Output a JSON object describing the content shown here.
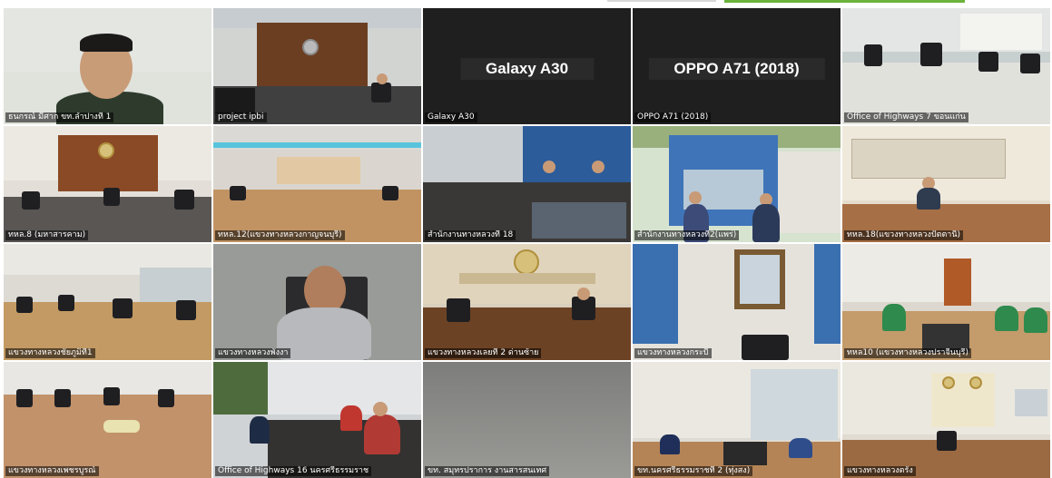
{
  "tiles": [
    {
      "id": "t1",
      "label": "ธนกรณ์ มีศาก ขท.ลำปางที่ 1"
    },
    {
      "id": "t2",
      "label": "project ipbi"
    },
    {
      "id": "t3",
      "label": "Galaxy A30",
      "center_name": "Galaxy A30"
    },
    {
      "id": "t4",
      "label": "OPPO A71 (2018)",
      "center_name": "OPPO A71 (2018)"
    },
    {
      "id": "t5",
      "label": "Office of Highways 7 ขอนแก่น"
    },
    {
      "id": "t6",
      "label": "ทหล.8 (มหาสารคาม)"
    },
    {
      "id": "t7",
      "label": "ทหล.12(แขวงทางหลวงกาญจนบุรี)"
    },
    {
      "id": "t8",
      "label": "สำนักงานทางหลวงที่ 18"
    },
    {
      "id": "t9",
      "label": "สำนักงานทางหลวงที่2(แพร่)"
    },
    {
      "id": "t10",
      "label": "ทหล.18(แขวงทางหลวงปัตตานี)"
    },
    {
      "id": "t11",
      "label": "แขวงทางหลวงชัยภูมิที่1"
    },
    {
      "id": "t12",
      "label": "แขวงทางหลวงพังงา"
    },
    {
      "id": "t13",
      "label": "แขวงทางหลวงเลยที่ 2 ด่านซ้าย"
    },
    {
      "id": "t14",
      "label": "แขวงทางหลวงกระบี่"
    },
    {
      "id": "t15",
      "label": "ทหล10 (แขวงทางหลวงปราจีนบุรี)"
    },
    {
      "id": "t16",
      "label": "แขวงทางหลวงเพชรบูรณ์"
    },
    {
      "id": "t17",
      "label": "Office of Highways 16 นครศรีธรรมราช"
    },
    {
      "id": "t18",
      "label": "ขท. สมุทรปราการ งานสารสนเทศ"
    },
    {
      "id": "t19",
      "label": "ขท.นครศรีธรรมราชที่ 2 (ทุ่งสง)"
    },
    {
      "id": "t20",
      "label": "แขวงทางหลวงตรัง"
    }
  ],
  "colors": {
    "accent": "#6bb33a",
    "label_bg": "#000000",
    "blank_tile": "#1f1f1f"
  }
}
